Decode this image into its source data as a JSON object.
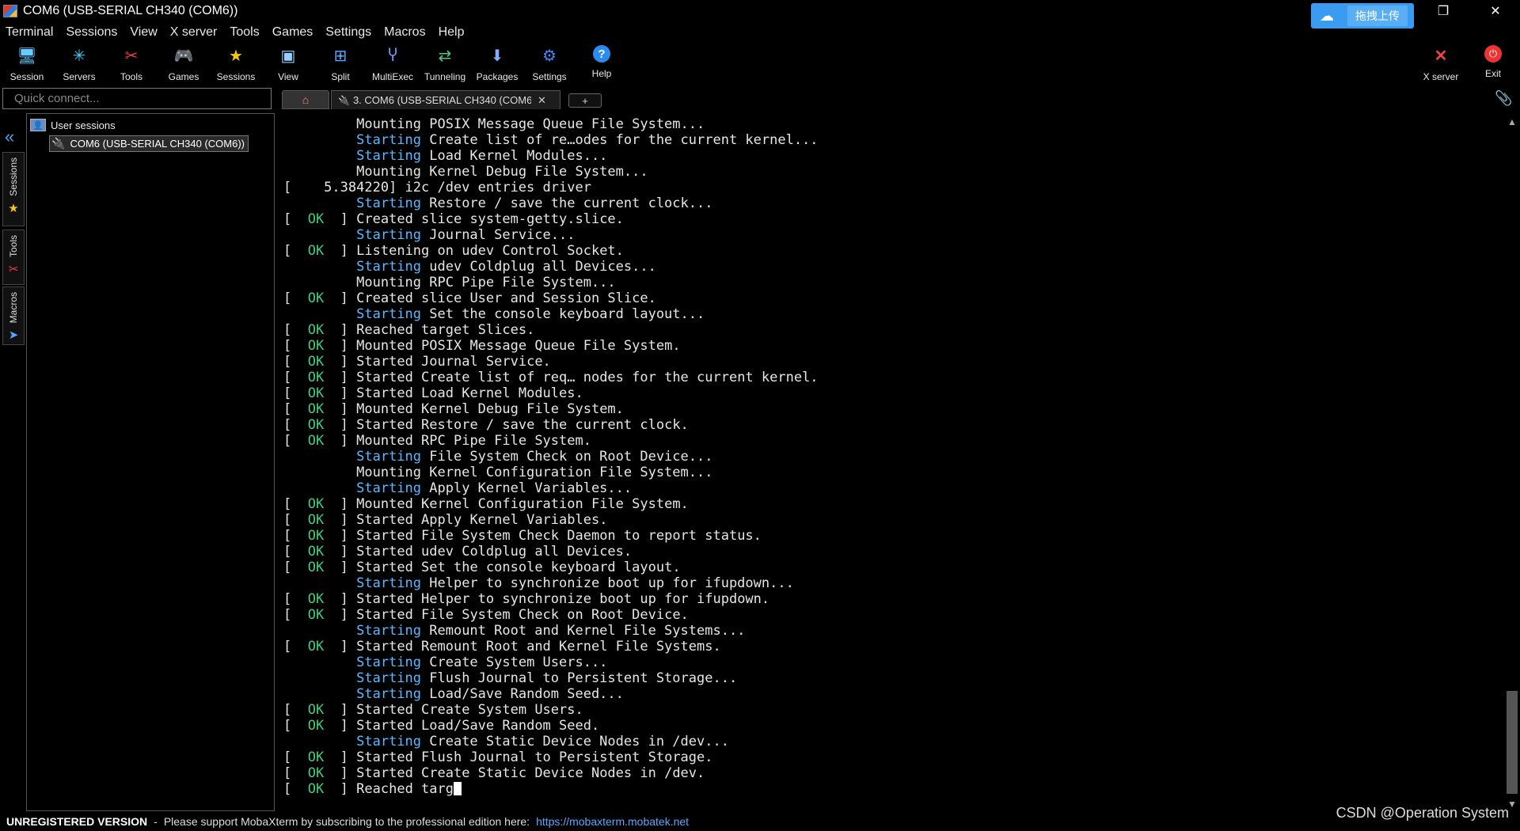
{
  "window": {
    "title": "COM6  (USB-SERIAL CH340 (COM6))",
    "upload_label": "拖拽上传",
    "controls": [
      "—",
      "❐",
      "✕"
    ]
  },
  "menu": [
    "Terminal",
    "Sessions",
    "View",
    "X server",
    "Tools",
    "Games",
    "Settings",
    "Macros",
    "Help"
  ],
  "toolbar": {
    "items": [
      {
        "label": "Session",
        "icon": "session-icon"
      },
      {
        "label": "Servers",
        "icon": "servers-icon"
      },
      {
        "label": "Tools",
        "icon": "tools-icon"
      },
      {
        "label": "Games",
        "icon": "games-icon"
      },
      {
        "label": "Sessions",
        "icon": "star-icon"
      },
      {
        "label": "View",
        "icon": "view-icon"
      },
      {
        "label": "Split",
        "icon": "split-icon"
      },
      {
        "label": "MultiExec",
        "icon": "multiexec-icon"
      },
      {
        "label": "Tunneling",
        "icon": "tunneling-icon"
      },
      {
        "label": "Packages",
        "icon": "packages-icon"
      },
      {
        "label": "Settings",
        "icon": "settings-icon"
      },
      {
        "label": "Help",
        "icon": "help-icon"
      }
    ],
    "xserver_label": "X server",
    "exit_label": "Exit"
  },
  "quick_connect": {
    "placeholder": "Quick connect..."
  },
  "tabs": {
    "active_label": "3. COM6  (USB-SERIAL CH340 (COM6))",
    "new_tab": "+"
  },
  "side_tabs": [
    "Sessions",
    "Tools",
    "Macros"
  ],
  "sessions_tree": {
    "root": "User sessions",
    "child": "COM6  (USB-SERIAL CH340 (COM6))"
  },
  "terminal": {
    "lines": [
      {
        "kind": "plain",
        "text": "Mounting POSIX Message Queue File System..."
      },
      {
        "kind": "starting",
        "text": "Create list of re…odes for the current kernel..."
      },
      {
        "kind": "starting",
        "text": "Load Kernel Modules..."
      },
      {
        "kind": "plain",
        "text": "Mounting Kernel Debug File System..."
      },
      {
        "kind": "raw",
        "text": "[    5.384220] i2c /dev entries driver"
      },
      {
        "kind": "starting",
        "text": "Restore / save the current clock..."
      },
      {
        "kind": "ok",
        "text": "Created slice system-getty.slice."
      },
      {
        "kind": "starting",
        "text": "Journal Service..."
      },
      {
        "kind": "ok",
        "text": "Listening on udev Control Socket."
      },
      {
        "kind": "starting",
        "text": "udev Coldplug all Devices..."
      },
      {
        "kind": "plain",
        "text": "Mounting RPC Pipe File System..."
      },
      {
        "kind": "ok",
        "text": "Created slice User and Session Slice."
      },
      {
        "kind": "starting",
        "text": "Set the console keyboard layout..."
      },
      {
        "kind": "ok",
        "text": "Reached target Slices."
      },
      {
        "kind": "ok",
        "text": "Mounted POSIX Message Queue File System."
      },
      {
        "kind": "ok",
        "text": "Started Journal Service."
      },
      {
        "kind": "ok",
        "text": "Started Create list of req… nodes for the current kernel."
      },
      {
        "kind": "ok",
        "text": "Started Load Kernel Modules."
      },
      {
        "kind": "ok",
        "text": "Mounted Kernel Debug File System."
      },
      {
        "kind": "ok",
        "text": "Started Restore / save the current clock."
      },
      {
        "kind": "ok",
        "text": "Mounted RPC Pipe File System."
      },
      {
        "kind": "starting",
        "text": "File System Check on Root Device..."
      },
      {
        "kind": "plain",
        "text": "Mounting Kernel Configuration File System..."
      },
      {
        "kind": "starting",
        "text": "Apply Kernel Variables..."
      },
      {
        "kind": "ok",
        "text": "Mounted Kernel Configuration File System."
      },
      {
        "kind": "ok",
        "text": "Started Apply Kernel Variables."
      },
      {
        "kind": "ok",
        "text": "Started File System Check Daemon to report status."
      },
      {
        "kind": "ok",
        "text": "Started udev Coldplug all Devices."
      },
      {
        "kind": "ok",
        "text": "Started Set the console keyboard layout."
      },
      {
        "kind": "starting",
        "text": "Helper to synchronize boot up for ifupdown..."
      },
      {
        "kind": "ok",
        "text": "Started Helper to synchronize boot up for ifupdown."
      },
      {
        "kind": "ok",
        "text": "Started File System Check on Root Device."
      },
      {
        "kind": "starting",
        "text": "Remount Root and Kernel File Systems..."
      },
      {
        "kind": "ok",
        "text": "Started Remount Root and Kernel File Systems."
      },
      {
        "kind": "starting",
        "text": "Create System Users..."
      },
      {
        "kind": "starting",
        "text": "Flush Journal to Persistent Storage..."
      },
      {
        "kind": "starting",
        "text": "Load/Save Random Seed..."
      },
      {
        "kind": "ok",
        "text": "Started Create System Users."
      },
      {
        "kind": "ok",
        "text": "Started Load/Save Random Seed."
      },
      {
        "kind": "starting",
        "text": "Create Static Device Nodes in /dev..."
      },
      {
        "kind": "ok",
        "text": "Started Flush Journal to Persistent Storage."
      },
      {
        "kind": "ok",
        "text": "Started Create Static Device Nodes in /dev."
      },
      {
        "kind": "ok_cursor",
        "text": "Reached targ"
      }
    ],
    "ok_word": "OK",
    "starting_word": "Starting"
  },
  "status": {
    "unregistered": "UNREGISTERED VERSION",
    "separator": "-",
    "message": "Please support MobaXterm by subscribing to the professional edition here:",
    "link": "https://mobaxterm.mobatek.net"
  },
  "watermark": "CSDN @Operation System",
  "colors": {
    "ok": "#3fcf7a",
    "starting": "#5bb8ff",
    "link": "#5aa9ff",
    "upload": "#3b9bf0"
  }
}
